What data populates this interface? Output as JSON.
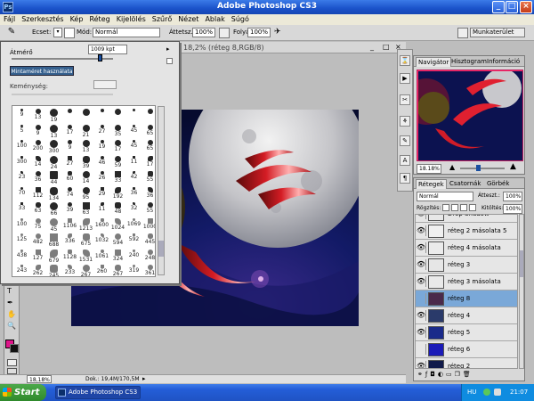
{
  "app": {
    "title": "Adobe Photoshop CS3",
    "logo": "Ps"
  },
  "menu": [
    "Fájl",
    "Szerkesztés",
    "Kép",
    "Réteg",
    "Kijelölés",
    "Szűrő",
    "Nézet",
    "Ablak",
    "Súgó"
  ],
  "options": {
    "brush_label": "Ecset:",
    "mode_label": "Mód:",
    "mode_value": "Normál",
    "opacity_label": "Áttetsz.:",
    "opacity_value": "100%",
    "flow_label": "Folyás:",
    "flow_value": "100%",
    "workspace_label": "Munkaterület"
  },
  "brush_popup": {
    "diameter_label": "Átmérő",
    "diameter_value": "1009 kpt",
    "diameter_level": 0.88,
    "use_sample_button": "Mintaméret használata",
    "hardness_label": "Keménység:",
    "sizes": [
      [
        "9",
        "13",
        "19",
        "",
        "",
        "",
        "",
        "",
        ""
      ],
      [
        "5",
        "9",
        "13",
        "17",
        "21",
        "27",
        "35",
        "45",
        "65"
      ],
      [
        "100",
        "200",
        "300",
        "9",
        "13",
        "19",
        "17",
        "45",
        "65"
      ],
      [
        "300",
        "14",
        "24",
        "27",
        "39",
        "46",
        "59",
        "11",
        "17"
      ],
      [
        "23",
        "36",
        "44",
        "60",
        "14",
        "26",
        "33",
        "42",
        "55"
      ],
      [
        "70",
        "112",
        "134",
        "74",
        "95",
        "29",
        "192",
        "36",
        "36"
      ],
      [
        "33",
        "63",
        "66",
        "39",
        "63",
        "11",
        "48",
        "32",
        "55"
      ],
      [
        "100",
        "75",
        "45",
        "1106",
        "1213",
        "1600",
        "1024",
        "1069",
        "1000"
      ],
      [
        "125",
        "482",
        "688",
        "336",
        "675",
        "1032",
        "594",
        "592",
        "445"
      ],
      [
        "438",
        "127",
        "679",
        "1128",
        "1531",
        "1061",
        "324",
        "240",
        "248"
      ],
      [
        "243",
        "262",
        "245",
        "233",
        "267",
        "260",
        "267",
        "319",
        "361"
      ]
    ]
  },
  "document": {
    "tab_title": "18,2% (réteg 8,RGB/8)",
    "zoom": "18,18%",
    "doc_info": "Dok.: 19,4M/170,5M"
  },
  "navigator": {
    "tabs": [
      "Navigátor",
      "Hisztogram",
      "Információ"
    ],
    "zoom": "18.18%"
  },
  "layers": {
    "tabs": [
      "Rétegek",
      "Csatornák",
      "Görbék"
    ],
    "blend_mode": "Normál",
    "opacity_label": "Átteszt.:",
    "opacity_value": "100%",
    "lock_label": "Rögzítés:",
    "fill_label": "Kitöltés:",
    "fill_value": "100%",
    "list": [
      {
        "name": "Drop Shadow",
        "visible": true,
        "selected": false,
        "thumb": "#e8e8e8"
      },
      {
        "name": "réteg 2 másolata 5",
        "visible": true,
        "selected": false,
        "thumb": "#f0f0f0"
      },
      {
        "name": "réteg 4 másolata",
        "visible": true,
        "selected": false,
        "thumb": "#ebebeb"
      },
      {
        "name": "réteg 3",
        "visible": true,
        "selected": false,
        "thumb": "#e6e6e6"
      },
      {
        "name": "réteg 3 másolata",
        "visible": true,
        "selected": false,
        "thumb": "#e9e9e9"
      },
      {
        "name": "réteg 8",
        "visible": false,
        "selected": true,
        "thumb": "#4a2a4a"
      },
      {
        "name": "réteg 4",
        "visible": true,
        "selected": false,
        "thumb": "#2a3a6a"
      },
      {
        "name": "réteg 5",
        "visible": true,
        "selected": false,
        "thumb": "#1a2a8a"
      },
      {
        "name": "réteg 6",
        "visible": false,
        "selected": false,
        "thumb": "#1b1bb8"
      },
      {
        "name": "réteg 2",
        "visible": true,
        "selected": false,
        "thumb": "#101a4a"
      }
    ]
  },
  "taskbar": {
    "start_label": "Start",
    "task_label": "Adobe Photoshop CS3",
    "language": "HU",
    "clock": "21:07"
  },
  "colors": {
    "foreground": "#e0148a",
    "background": "#111111",
    "titlebar": "#2158d1",
    "selection": "#7aa8d8"
  }
}
